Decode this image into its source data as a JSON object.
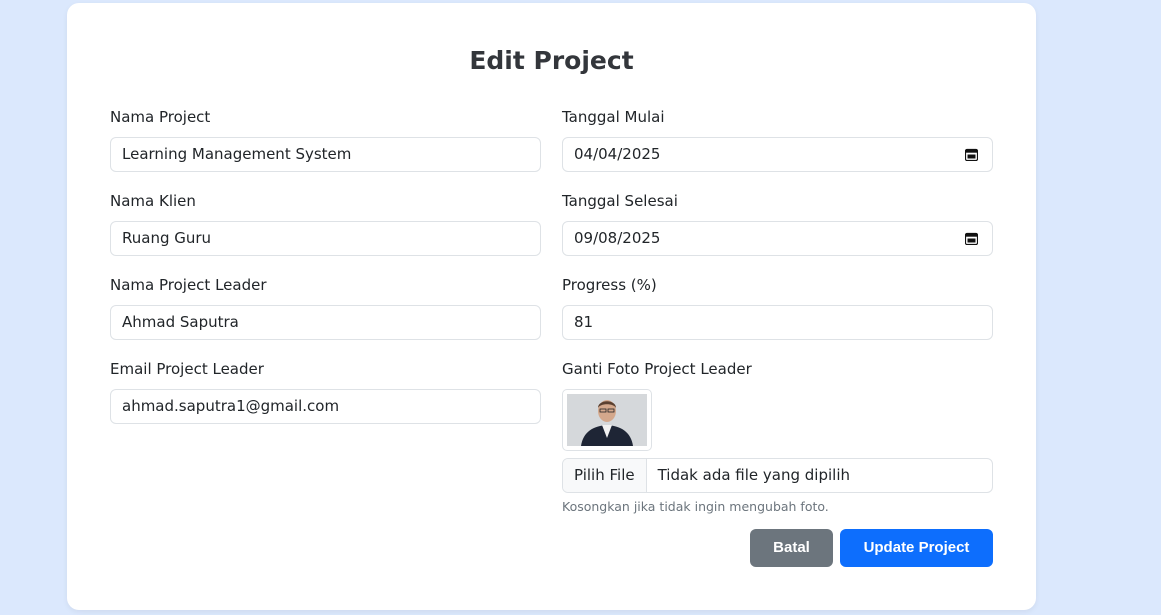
{
  "form": {
    "title": "Edit Project",
    "fields": {
      "nama_project": {
        "label": "Nama Project",
        "value": "Learning Management System"
      },
      "nama_klien": {
        "label": "Nama Klien",
        "value": "Ruang Guru"
      },
      "nama_leader": {
        "label": "Nama Project Leader",
        "value": "Ahmad Saputra"
      },
      "email_leader": {
        "label": "Email Project Leader",
        "value": "ahmad.saputra1@gmail.com"
      },
      "tanggal_mulai": {
        "label": "Tanggal Mulai",
        "value": "04/04/2025"
      },
      "tanggal_selesai": {
        "label": "Tanggal Selesai",
        "value": "09/08/2025"
      },
      "progress": {
        "label": "Progress (%)",
        "value": "81"
      }
    },
    "photo": {
      "label": "Ganti Foto Project Leader",
      "file_button": "Pilih File",
      "file_status": "Tidak ada file yang dipilih",
      "hint": "Kosongkan jika tidak ingin mengubah foto."
    },
    "buttons": {
      "cancel": "Batal",
      "submit": "Update Project"
    }
  },
  "colors": {
    "page_background": "#dbe8fd",
    "primary": "#0d6efd",
    "secondary": "#6c757d"
  }
}
